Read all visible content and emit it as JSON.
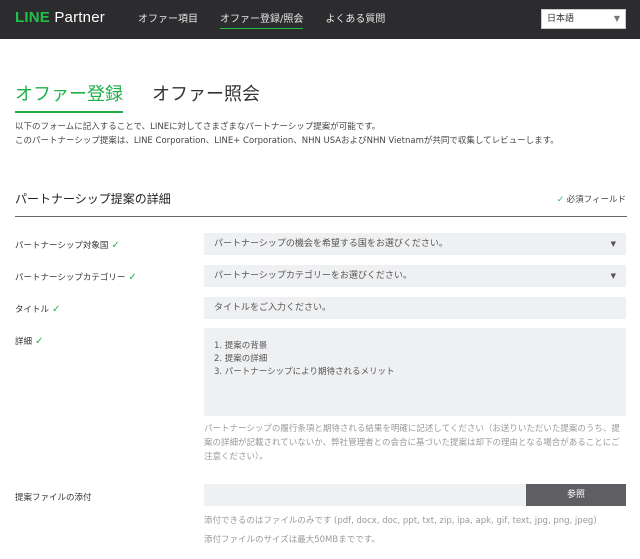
{
  "header": {
    "logo_brand": "LINE",
    "logo_suffix": "Partner",
    "nav": [
      {
        "label": "オファー項目"
      },
      {
        "label": "オファー登録/照会"
      },
      {
        "label": "よくある質問"
      }
    ],
    "language": "日本語",
    "colors": {
      "bar": "#2c2c2f",
      "accent": "#20c149"
    }
  },
  "tabs": {
    "register": "オファー登録",
    "inquiry": "オファー照会"
  },
  "intro": {
    "line1": "以下のフォームに記入することで、LINEに対してさまざまなパートナーシップ提案が可能です。",
    "line2": "このパートナーシップ提案は、LINE Corporation、LINE+ Corporation、NHN USAおよびNHN Vietnamが共同で収集してレビューします。"
  },
  "section": {
    "title": "パートナーシップ提案の詳細",
    "required_label": "必須フィールド",
    "check_icon": "✓"
  },
  "form": {
    "country": {
      "label": "パートナーシップ対象国",
      "placeholder": "パートナーシップの機会を希望する国をお選びください。"
    },
    "category": {
      "label": "パートナーシップカテゴリー",
      "placeholder": "パートナーシップカテゴリーをお選びください。"
    },
    "title": {
      "label": "タイトル",
      "placeholder": "タイトルをご入力ください。"
    },
    "details": {
      "label": "詳細",
      "placeholder": "1. 提案の背景\n2. 提案の詳細\n3. パートナーシップにより期待されるメリット",
      "note": "パートナーシップの履行条項と期待される結果を明確に記述してください（お送りいただいた提案のうち、提案の詳細が記載されていないか、弊社管理者との会合に基づいた提案は却下の理由となる場合があることにご注意ください）。"
    },
    "attachment": {
      "label": "提案ファイルの添付",
      "button": "参照",
      "note_types": "添付できるのはファイルのみです (pdf, docx, doc, ppt, txt, zip, ipa, apk, gif, text, jpg, png, jpeg)",
      "note_size": "添付ファイルのサイズは最大50MBまでです。"
    }
  }
}
